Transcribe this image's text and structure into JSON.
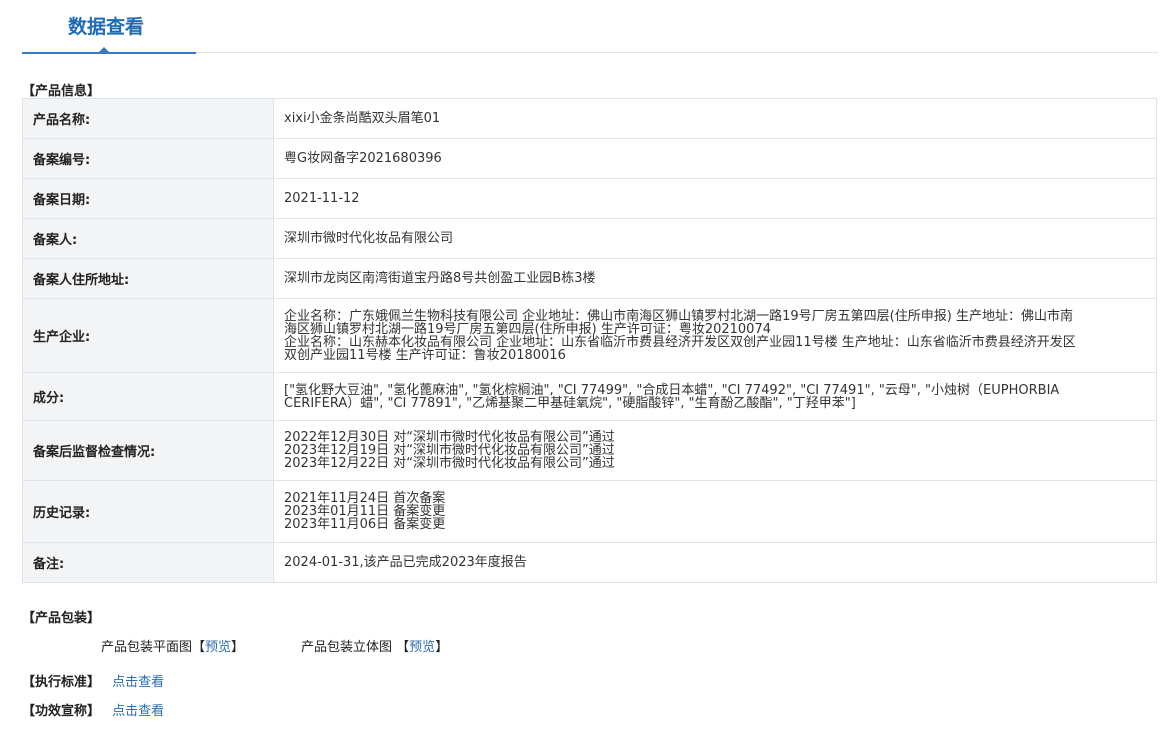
{
  "tab": {
    "title": "数据查看"
  },
  "sections": {
    "product_info": "【产品信息】",
    "packaging": "【产品包装】"
  },
  "product": {
    "rows": [
      {
        "label": "产品名称:",
        "lines": [
          "xixi小金条尚酷双头眉笔01"
        ]
      },
      {
        "label": "备案编号:",
        "lines": [
          "粤G妆网备字2021680396"
        ]
      },
      {
        "label": "备案日期:",
        "lines": [
          "2021-11-12"
        ]
      },
      {
        "label": "备案人:",
        "lines": [
          "深圳市微时代化妆品有限公司"
        ]
      },
      {
        "label": "备案人住所地址:",
        "lines": [
          "深圳市龙岗区南湾街道宝丹路8号共创盈工业园B栋3楼"
        ]
      },
      {
        "label": "生产企业:",
        "lines": [
          "企业名称：广东娥佩兰生物科技有限公司 企业地址：佛山市南海区狮山镇罗村北湖一路19号厂房五第四层(住所申报) 生产地址：佛山市南",
          "海区狮山镇罗村北湖一路19号厂房五第四层(住所申报) 生产许可证：粤妆20210074",
          "企业名称：山东赫本化妆品有限公司 企业地址：山东省临沂市费县经济开发区双创产业园11号楼 生产地址：山东省临沂市费县经济开发区",
          "双创产业园11号楼 生产许可证：鲁妆20180016"
        ]
      },
      {
        "label": "成分:",
        "lines": [
          "[\"氢化野大豆油\", \"氢化蓖麻油\", \"氢化棕榈油\", \"CI 77499\", \"合成日本蜡\", \"CI 77492\", \"CI 77491\", \"云母\", \"小烛树（EUPHORBIA",
          "CERIFERA）蜡\", \"CI 77891\", \"乙烯基聚二甲基硅氧烷\", \"硬脂酸锌\", \"生育酚乙酸酯\", \"丁羟甲苯\"]"
        ]
      },
      {
        "label": "备案后监督检查情况:",
        "lines": [
          "2022年12月30日 对“深圳市微时代化妆品有限公司”通过",
          "2023年12月19日 对“深圳市微时代化妆品有限公司”通过",
          "2023年12月22日 对“深圳市微时代化妆品有限公司”通过"
        ]
      },
      {
        "label": "历史记录:",
        "lines": [
          "2021年11月24日 首次备案",
          "2023年01月11日 备案变更",
          "2023年11月06日 备案变更"
        ]
      },
      {
        "label": "备注:",
        "lines": [
          "2024-01-31,该产品已完成2023年度报告"
        ]
      }
    ]
  },
  "packaging": {
    "flat_label": "产品包装平面图",
    "stereo_label": "产品包装立体图",
    "bracket_open": "【",
    "bracket_close": "】",
    "preview_link": "预览"
  },
  "standard": {
    "label": "【执行标准】",
    "link": "点击查看"
  },
  "efficacy": {
    "label": "【功效宣称】",
    "link": "点击查看"
  }
}
